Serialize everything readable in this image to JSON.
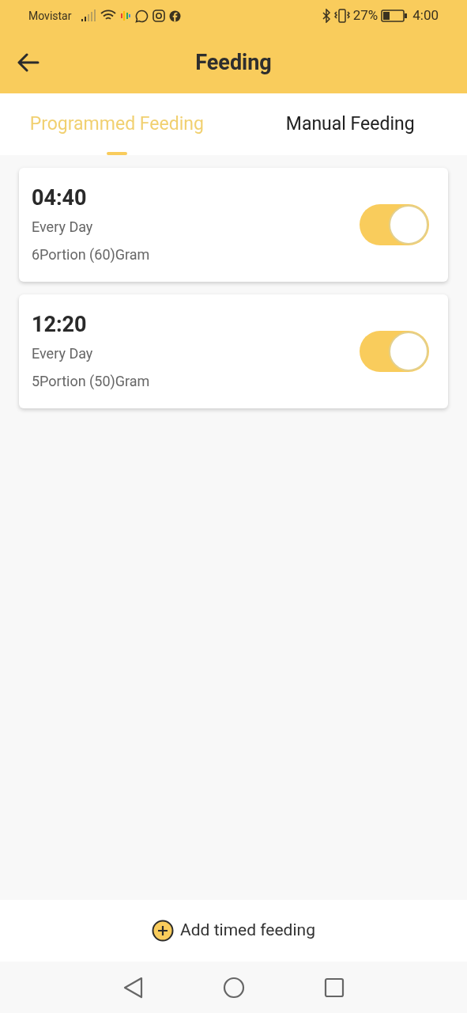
{
  "status_bar": {
    "carrier": "Movistar",
    "battery_percent": "27%",
    "time": "4:00"
  },
  "header": {
    "title": "Feeding"
  },
  "tabs": [
    {
      "label": "Programmed Feeding",
      "selected": true
    },
    {
      "label": "Manual Feeding",
      "selected": false
    }
  ],
  "schedules": [
    {
      "time": "04:40",
      "repeat": "Every Day",
      "amount": "6Portion (60)Gram",
      "on": true
    },
    {
      "time": "12:20",
      "repeat": "Every Day",
      "amount": "5Portion (50)Gram",
      "on": true
    }
  ],
  "add_button": {
    "label": "Add timed feeding"
  }
}
